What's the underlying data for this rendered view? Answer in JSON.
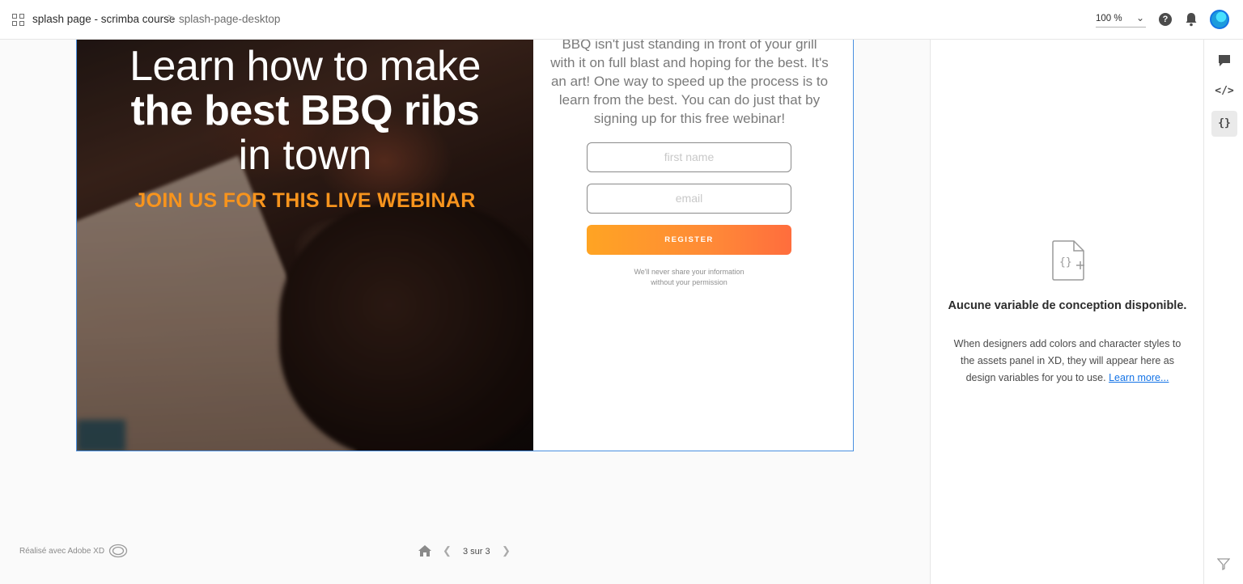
{
  "header": {
    "project_name": "splash page - scrimba course",
    "separator": ">",
    "page_name": "splash-page-desktop",
    "zoom_value": "100 %",
    "help_label": "?"
  },
  "artboard": {
    "hero": {
      "line1": "Learn how to make",
      "line2": "the best BBQ ribs",
      "line3": "in town",
      "line4": "JOIN US FOR THIS LIVE WEBINAR"
    },
    "intro_text": "BBQ isn't just standing in front of your grill with it on full blast and hoping for the best. It's an art! One way to speed up the process is to learn from the best. You can do just that by signing up for this free webinar!",
    "first_name_placeholder": "first name",
    "email_placeholder": "email",
    "register_label": "REGISTER",
    "privacy_line1": "We'll never share your information",
    "privacy_line2": "without your permission"
  },
  "panel": {
    "title": "Aucune variable de conception disponible.",
    "description": "When designers add colors and character styles to the assets panel in XD, they will appear here as design variables for you to use.",
    "link_label": "Learn more..."
  },
  "rail": {
    "comment_icon": "comment-icon",
    "code_label": "</>",
    "variables_label": "{}"
  },
  "footer": {
    "made_with": "Réalisé avec Adobe XD",
    "page_counter": "3 sur 3"
  },
  "colors": {
    "accent": "#1473e6",
    "brand_orange": "#f7941d",
    "register_gradient_start": "#ffa423",
    "register_gradient_end": "#ff6d3d"
  }
}
